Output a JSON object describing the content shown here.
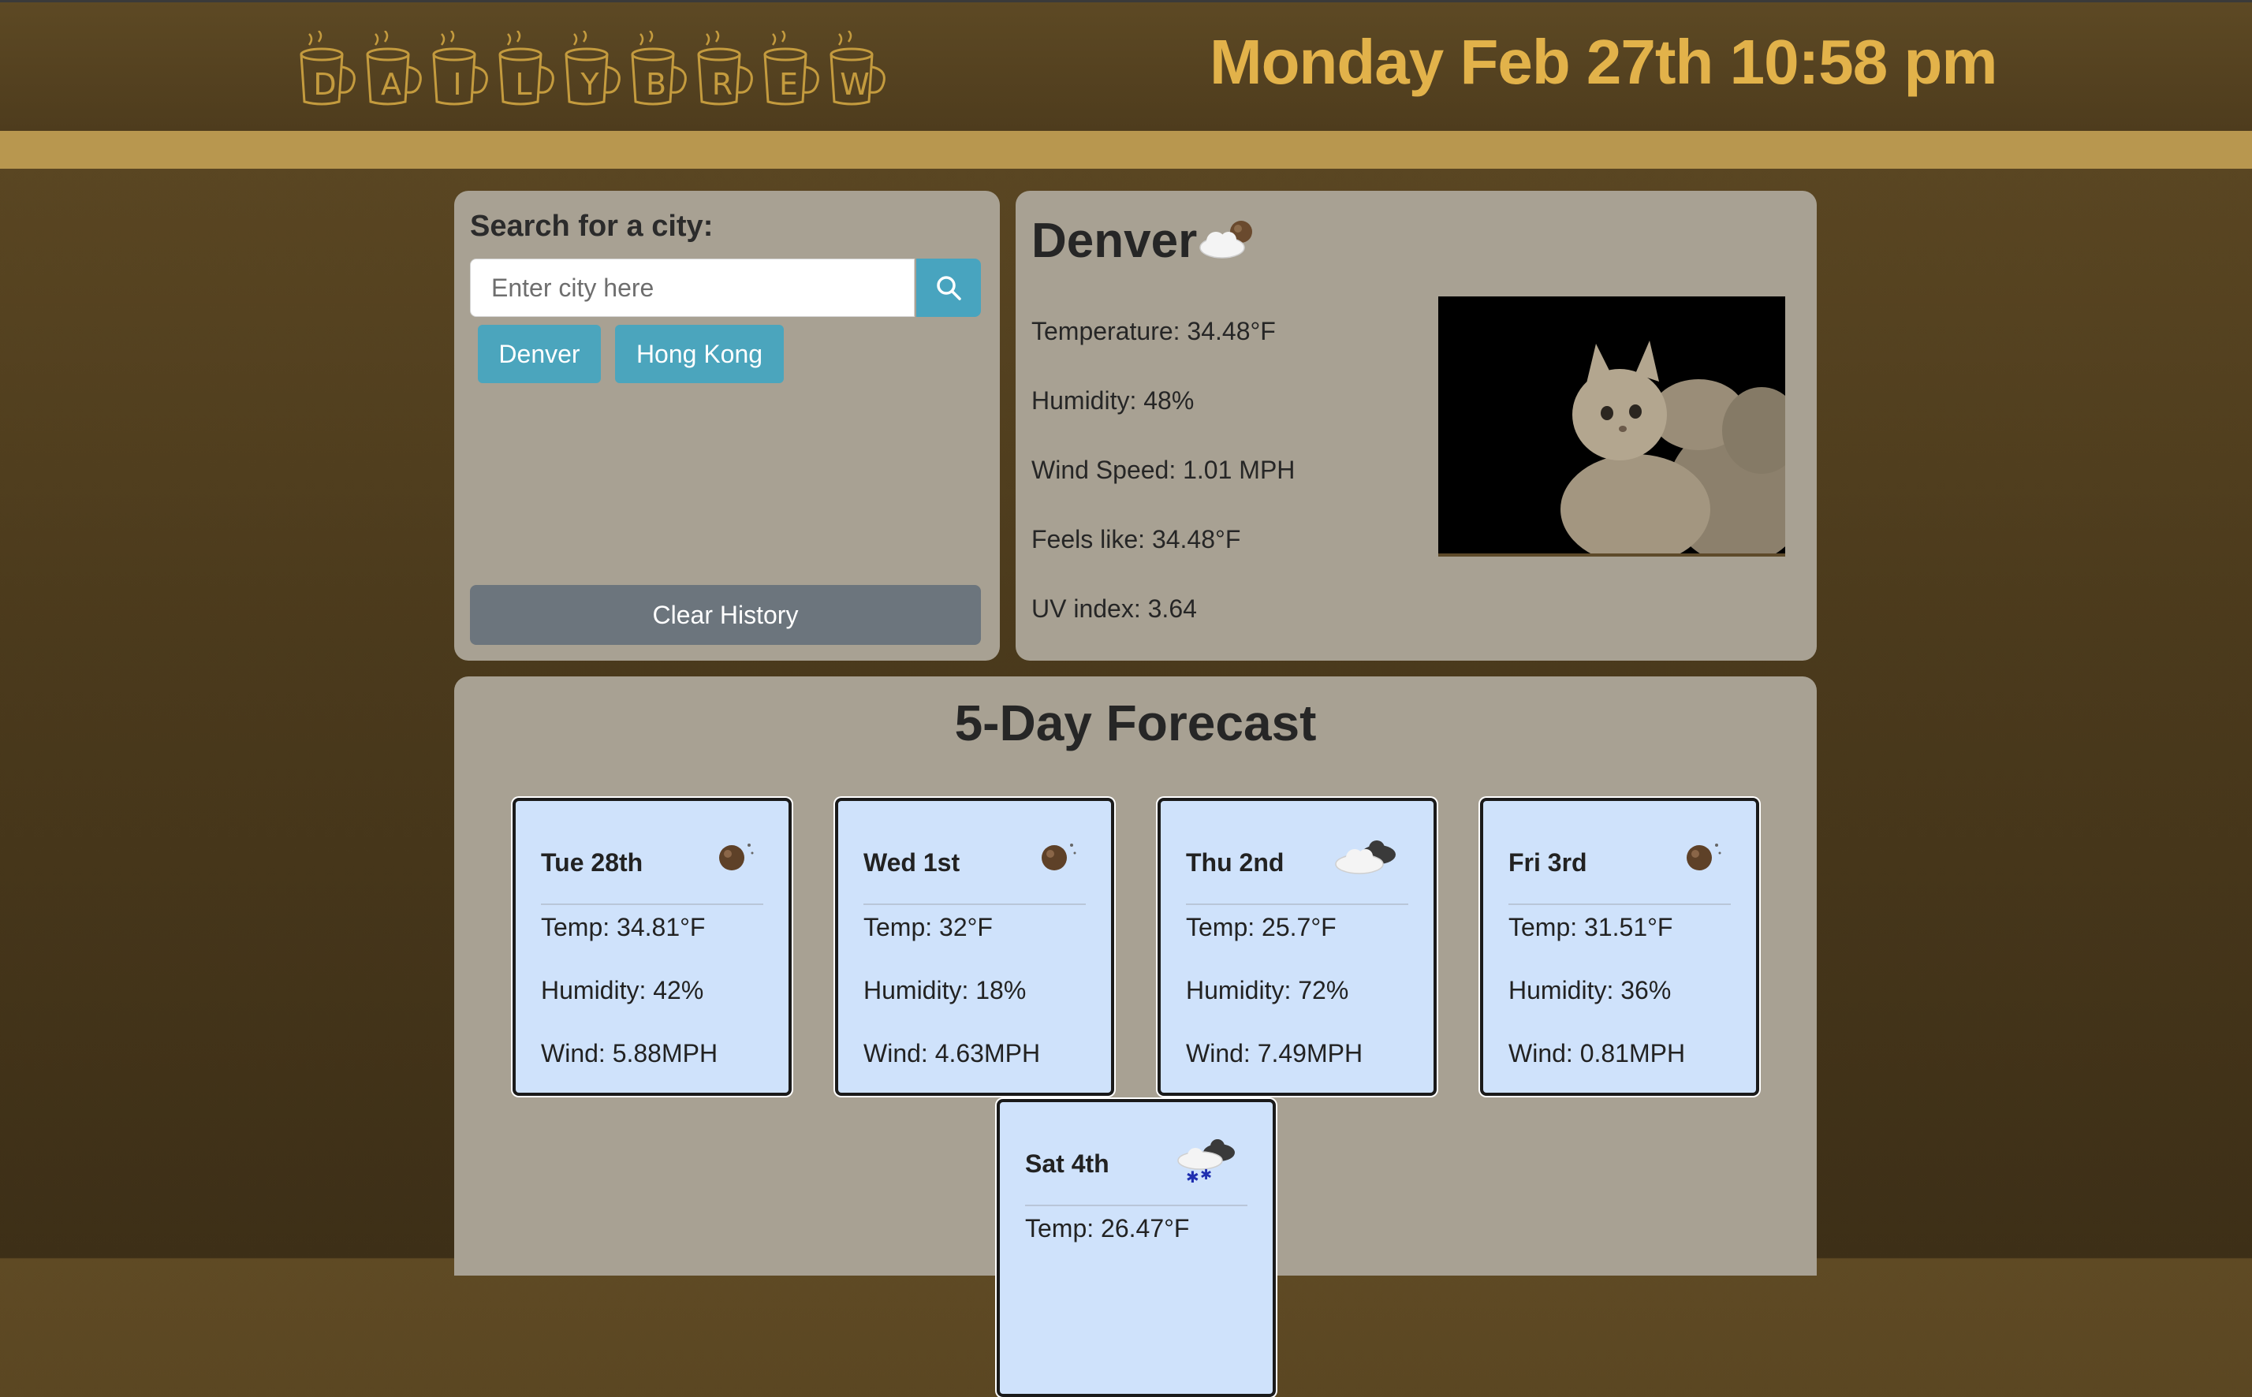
{
  "header": {
    "logo_letters": [
      "D",
      "A",
      "I",
      "L",
      "Y",
      "B",
      "R",
      "E",
      "W"
    ],
    "datetime": "Monday Feb 27th 10:58 pm"
  },
  "search": {
    "label": "Search for a city:",
    "placeholder": "Enter city here",
    "value": "",
    "history": [
      "Denver",
      "Hong Kong"
    ],
    "clear_label": "Clear History"
  },
  "current": {
    "city": "Denver",
    "icon": "partly-cloudy-night-icon",
    "temperature": "Temperature: 34.48°F",
    "humidity": "Humidity: 48%",
    "wind": "Wind Speed: 1.01 MPH",
    "feels_like": "Feels like: 34.48°F",
    "uv": "UV index: 3.64"
  },
  "forecast": {
    "title": "5-Day Forecast",
    "days": [
      {
        "day": "Tue 28th",
        "icon": "clear-night-icon",
        "temp": "Temp: 34.81°F",
        "humidity": "Humidity: 42%",
        "wind": "Wind: 5.88MPH"
      },
      {
        "day": "Wed 1st",
        "icon": "clear-night-icon",
        "temp": "Temp: 32°F",
        "humidity": "Humidity: 18%",
        "wind": "Wind: 4.63MPH"
      },
      {
        "day": "Thu 2nd",
        "icon": "cloudy-icon",
        "temp": "Temp: 25.7°F",
        "humidity": "Humidity: 72%",
        "wind": "Wind: 7.49MPH"
      },
      {
        "day": "Fri 3rd",
        "icon": "clear-night-icon",
        "temp": "Temp: 31.51°F",
        "humidity": "Humidity: 36%",
        "wind": "Wind: 0.81MPH"
      },
      {
        "day": "Sat 4th",
        "icon": "snow-icon",
        "temp": "Temp: 26.47°F",
        "humidity": "",
        "wind": ""
      }
    ]
  },
  "colors": {
    "header_bg": "#5d4924",
    "stripe": "#b8974f",
    "accent_text": "#e2b24a",
    "panel_bg": "#a8a193",
    "button_blue": "#48a4bf",
    "clear_gray": "#6c757d",
    "card_bg": "#cfe2fb"
  }
}
